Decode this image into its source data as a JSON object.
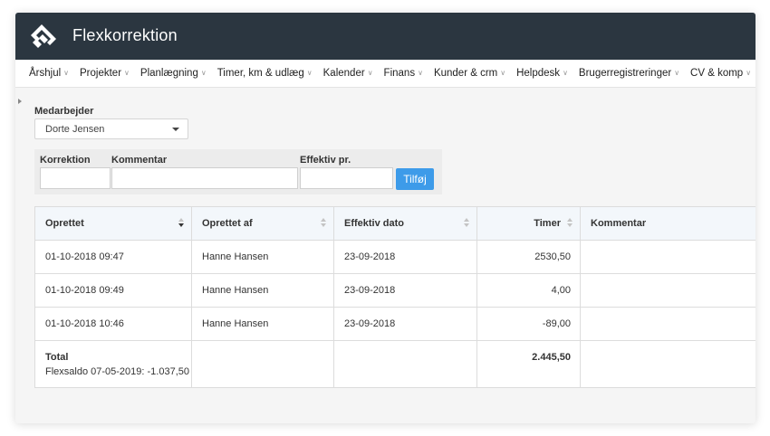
{
  "app": {
    "title": "Flexkorrektion",
    "colors": {
      "titlebar": "#2b3640",
      "accent": "#3d9be9"
    }
  },
  "menu": {
    "items": [
      {
        "label": "Årshjul"
      },
      {
        "label": "Projekter"
      },
      {
        "label": "Planlægning"
      },
      {
        "label": "Timer, km & udlæg"
      },
      {
        "label": "Kalender"
      },
      {
        "label": "Finans"
      },
      {
        "label": "Kunder & crm"
      },
      {
        "label": "Helpdesk"
      },
      {
        "label": "Brugerregistreringer"
      },
      {
        "label": "CV & komp"
      }
    ]
  },
  "employee": {
    "label": "Medarbejder",
    "selected": "Dorte Jensen"
  },
  "form": {
    "correction_label": "Korrektion",
    "comment_label": "Kommentar",
    "effective_label": "Effektiv pr.",
    "correction_value": "",
    "comment_value": "",
    "effective_value": "",
    "add_label": "Tilføj"
  },
  "table": {
    "columns": [
      {
        "label": "Oprettet",
        "sort": "descending"
      },
      {
        "label": "Oprettet af",
        "sort": "none"
      },
      {
        "label": "Effektiv dato",
        "sort": "none"
      },
      {
        "label": "Timer",
        "sort": "none"
      },
      {
        "label": "Kommentar"
      }
    ],
    "rows": [
      {
        "created": "01-10-2018 09:47",
        "created_by": "Hanne Hansen",
        "effective": "23-09-2018",
        "hours": "2530,50",
        "comment": ""
      },
      {
        "created": "01-10-2018 09:49",
        "created_by": "Hanne Hansen",
        "effective": "23-09-2018",
        "hours": "4,00",
        "comment": ""
      },
      {
        "created": "01-10-2018 10:46",
        "created_by": "Hanne Hansen",
        "effective": "23-09-2018",
        "hours": "-89,00",
        "comment": ""
      }
    ],
    "total": {
      "label": "Total",
      "flexsaldo": "Flexsaldo 07-05-2019: -1.037,50",
      "hours": "2.445,50"
    }
  }
}
